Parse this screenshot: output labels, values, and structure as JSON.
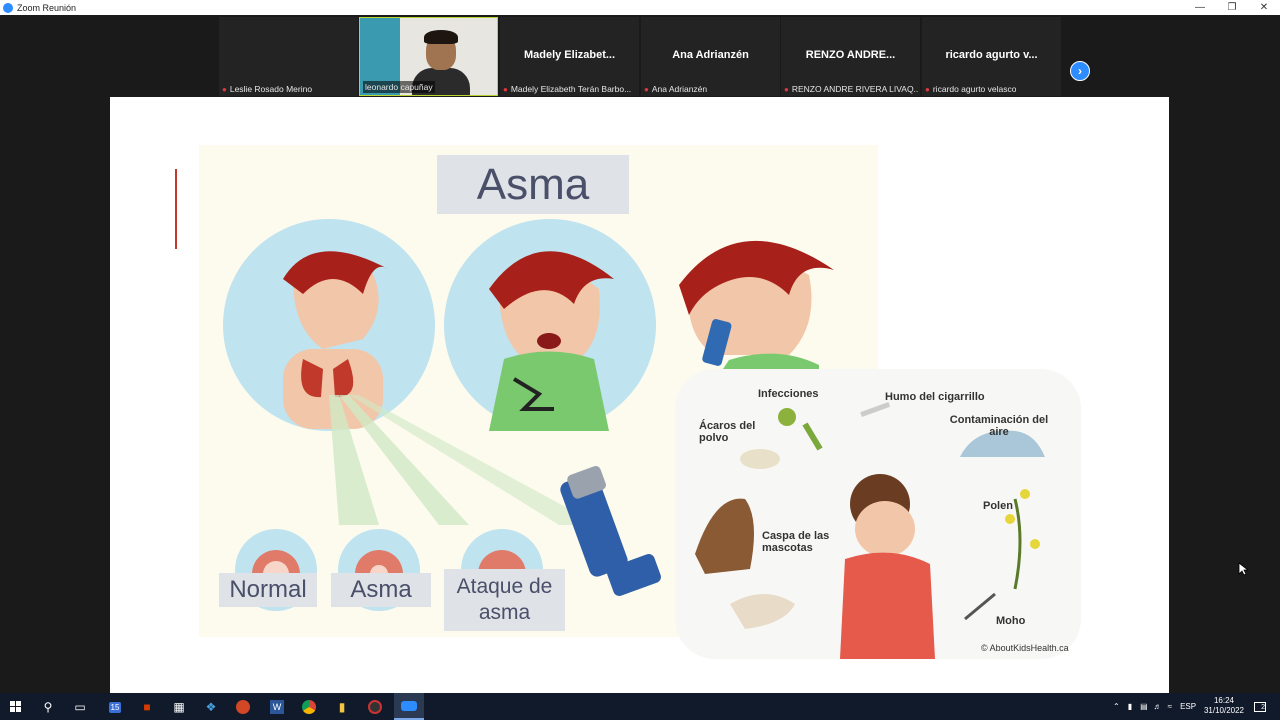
{
  "window": {
    "title": "Zoom Reunión"
  },
  "participants": [
    {
      "tile_name": "",
      "label": "Leslie Rosado Merino"
    },
    {
      "tile_name": "",
      "label": "leonardo capuñay",
      "active": true
    },
    {
      "tile_name": "Madely  Elizabet...",
      "label": "Madely Elizabeth Terán Barbo..."
    },
    {
      "tile_name": "Ana Adrianzén",
      "label": "Ana Adrianzén"
    },
    {
      "tile_name": "RENZO  ANDRE...",
      "label": "RENZO ANDRE RIVERA LIVAQ..."
    },
    {
      "tile_name": "ricardo  agurto  v...",
      "label": "ricardo agurto velasco"
    }
  ],
  "slide": {
    "title": "Asma",
    "labels": {
      "normal": "Normal",
      "asma": "Asma",
      "ataque": "Ataque de asma"
    },
    "triggers": {
      "infecciones": "Infecciones",
      "humo": "Humo del cigarrillo",
      "acaros": "Ácaros del polvo",
      "contaminacion": "Contaminación del aire",
      "caspa": "Caspa de las mascotas",
      "polen": "Polen",
      "moho": "Moho"
    },
    "copyright": "© AboutKidsHealth.ca"
  },
  "taskbar": {
    "badge": "15",
    "language": "ESP",
    "time": "16:24",
    "date": "31/10/2022",
    "notifications": "2"
  },
  "colors": {
    "zoom_blue": "#2d8cff",
    "label_bg": "#dfe2e6",
    "slide_text": "#4a4f6a"
  }
}
